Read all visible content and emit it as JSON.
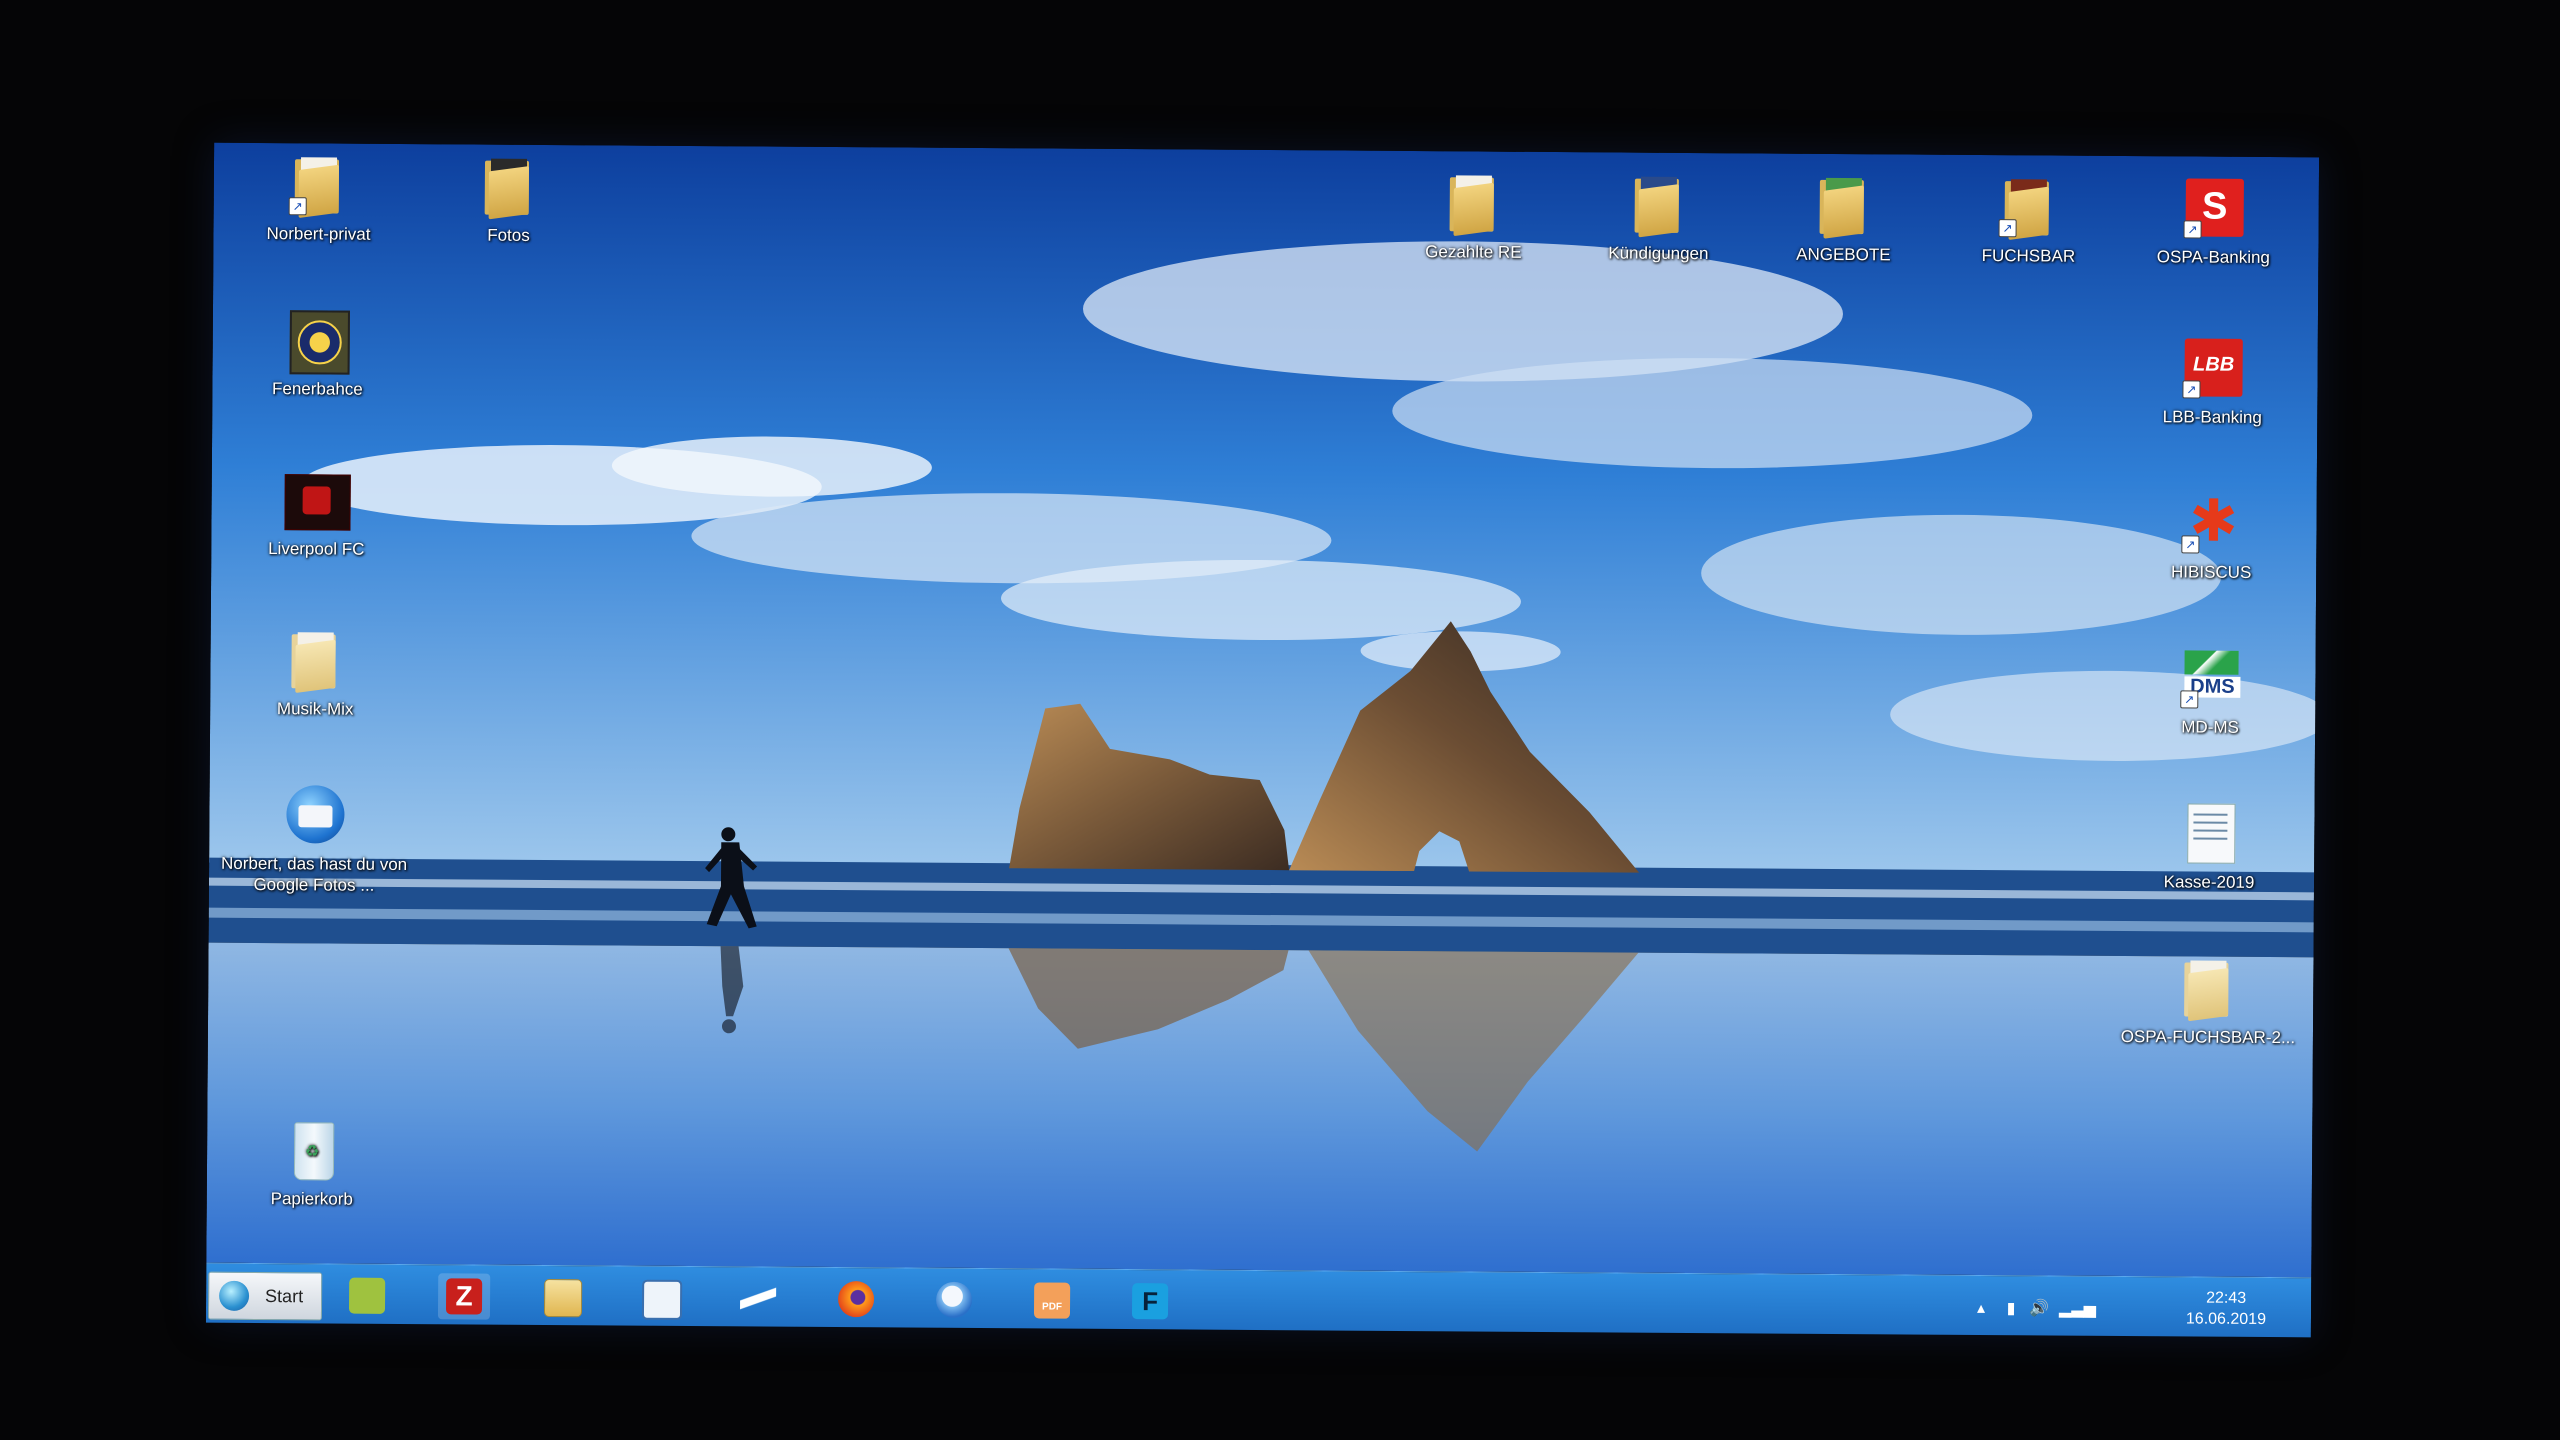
{
  "desktop": {
    "icons_left": [
      {
        "label": "Norbert-privat"
      },
      {
        "label": "Fotos"
      },
      {
        "label": "Fenerbahce"
      },
      {
        "label": "Liverpool FC"
      },
      {
        "label": "Musik-Mix"
      },
      {
        "label": "Norbert, das hast du von Google Fotos ..."
      },
      {
        "label": "Papierkorb"
      }
    ],
    "icons_top": [
      {
        "label": "Gezahlte RE"
      },
      {
        "label": "Kündigungen"
      },
      {
        "label": "ANGEBOTE"
      },
      {
        "label": "FUCHSBAR"
      },
      {
        "label": "OSPA-Banking"
      }
    ],
    "icons_right": [
      {
        "label": "LBB-Banking"
      },
      {
        "label": "HIBISCUS"
      },
      {
        "label": "MD-MS"
      },
      {
        "label": "Kasse-2019"
      },
      {
        "label": "OSPA-FUCHSBAR-2..."
      }
    ],
    "ospa_logo_text": "S",
    "lbb_logo_text": "LBB",
    "dms_logo_text": "DMS"
  },
  "taskbar": {
    "start_label": "Start",
    "apps": [
      {
        "icon": "cloud-icon"
      },
      {
        "icon": "filezilla-icon"
      },
      {
        "icon": "file-explorer-icon"
      },
      {
        "icon": "browser-window-icon"
      },
      {
        "icon": "scanner-icon"
      },
      {
        "icon": "firefox-icon"
      },
      {
        "icon": "mail-icon"
      },
      {
        "icon": "pdf-icon"
      },
      {
        "icon": "fsecure-icon"
      }
    ],
    "pdf_badge": "PDF",
    "clock_time": "22:43",
    "clock_date": "16.06.2019"
  },
  "colors": {
    "taskbar": "#2a82d8",
    "accent": "#1f6fc4"
  }
}
